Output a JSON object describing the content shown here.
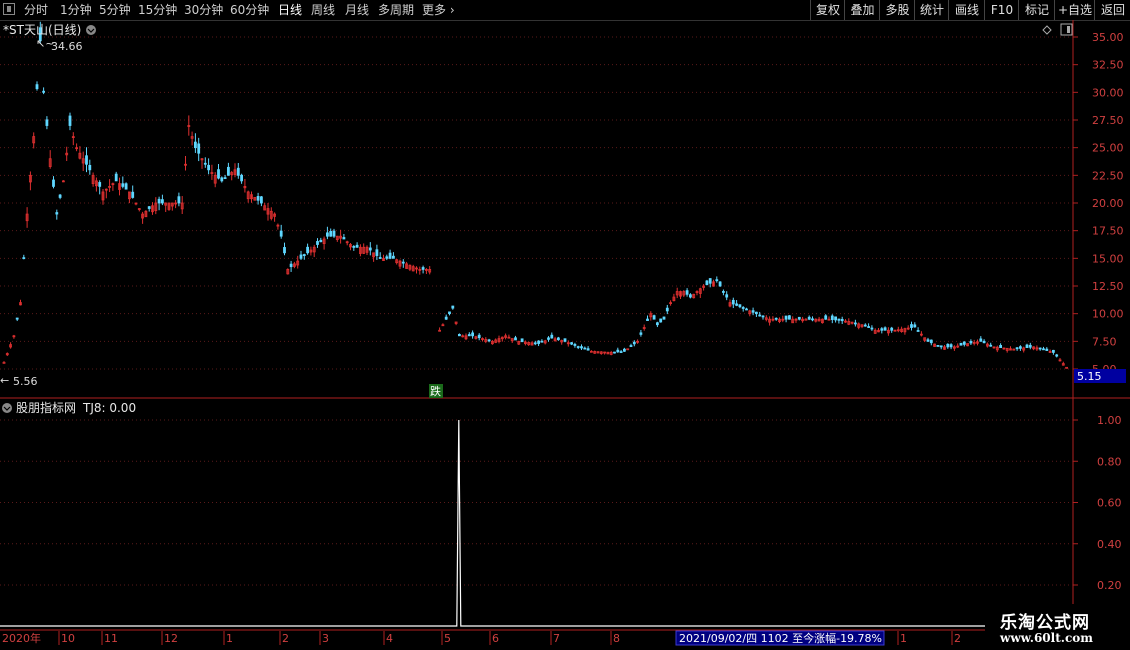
{
  "toolbar": {
    "periods": [
      "分时",
      "1分钟",
      "5分钟",
      "15分钟",
      "30分钟",
      "60分钟",
      "日线",
      "周线",
      "月线",
      "多周期",
      "更多"
    ],
    "active_index": 6,
    "buttons": [
      "复权",
      "叠加",
      "多股",
      "统计",
      "画线",
      "F10",
      "标记",
      "+自选",
      "返回"
    ]
  },
  "main_panel": {
    "title": "*ST天山(日线)",
    "high_label": "34.66",
    "low_label": "5.56",
    "last_price": "5.15",
    "signal_label": "跌"
  },
  "indicator_panel": {
    "title": "股朋指标网",
    "value_label": "TJ8: 0.00"
  },
  "bottom_axis": {
    "year_label": "2020年",
    "months": [
      "10",
      "11",
      "12",
      "1",
      "2",
      "3",
      "4",
      "5",
      "6",
      "7",
      "8",
      "1",
      "2"
    ],
    "status": "2021/09/02/四 1102 至今涨幅-19.78%"
  },
  "watermark": {
    "title": "乐淘公式网",
    "url": "www.60lt.com"
  },
  "colors": {
    "up": "#e03030",
    "down": "#5fd7ff",
    "axis": "#b02020",
    "grid": "#5a1a1a",
    "price_box": "#0000a0",
    "status_bg": "#000080"
  },
  "chart_data": [
    {
      "type": "candlestick",
      "title": "*ST天山(日线)",
      "y_ticks": [
        5.0,
        7.5,
        10.0,
        12.5,
        15.0,
        17.5,
        20.0,
        22.5,
        25.0,
        27.5,
        30.0,
        32.5,
        35.0
      ],
      "ylim": [
        4.5,
        36.5
      ],
      "annotations": {
        "high": 34.66,
        "low": 5.56,
        "last": 5.15
      },
      "close_path": [
        {
          "i": 0,
          "v": 5.6
        },
        {
          "i": 3,
          "v": 8
        },
        {
          "i": 5,
          "v": 11
        },
        {
          "i": 7,
          "v": 19
        },
        {
          "i": 9,
          "v": 26
        },
        {
          "i": 11,
          "v": 34.66
        },
        {
          "i": 12,
          "v": 30
        },
        {
          "i": 14,
          "v": 24
        },
        {
          "i": 16,
          "v": 19
        },
        {
          "i": 18,
          "v": 22
        },
        {
          "i": 20,
          "v": 27
        },
        {
          "i": 22,
          "v": 25
        },
        {
          "i": 26,
          "v": 23
        },
        {
          "i": 30,
          "v": 21
        },
        {
          "i": 34,
          "v": 22
        },
        {
          "i": 38,
          "v": 21
        },
        {
          "i": 42,
          "v": 19
        },
        {
          "i": 46,
          "v": 20
        },
        {
          "i": 50,
          "v": 20
        },
        {
          "i": 54,
          "v": 20
        },
        {
          "i": 56,
          "v": 27
        },
        {
          "i": 58,
          "v": 25
        },
        {
          "i": 62,
          "v": 23
        },
        {
          "i": 66,
          "v": 22
        },
        {
          "i": 70,
          "v": 23
        },
        {
          "i": 74,
          "v": 21
        },
        {
          "i": 78,
          "v": 20
        },
        {
          "i": 82,
          "v": 19
        },
        {
          "i": 84,
          "v": 17
        },
        {
          "i": 86,
          "v": 14
        },
        {
          "i": 90,
          "v": 15
        },
        {
          "i": 94,
          "v": 16
        },
        {
          "i": 98,
          "v": 17
        },
        {
          "i": 102,
          "v": 17
        },
        {
          "i": 106,
          "v": 16
        },
        {
          "i": 110,
          "v": 16
        },
        {
          "i": 114,
          "v": 15
        },
        {
          "i": 118,
          "v": 15
        },
        {
          "i": 122,
          "v": 14.5
        },
        {
          "i": 126,
          "v": 14
        },
        {
          "i": 129,
          "v": 14
        },
        {
          "i": 132,
          "v": 8.5
        },
        {
          "i": 134,
          "v": 9.5
        },
        {
          "i": 136,
          "v": 10.5
        },
        {
          "i": 138,
          "v": 8
        },
        {
          "i": 142,
          "v": 8
        },
        {
          "i": 148,
          "v": 7.5
        },
        {
          "i": 152,
          "v": 8
        },
        {
          "i": 156,
          "v": 7.5
        },
        {
          "i": 162,
          "v": 7.3
        },
        {
          "i": 166,
          "v": 7.8
        },
        {
          "i": 170,
          "v": 7.5
        },
        {
          "i": 174,
          "v": 7
        },
        {
          "i": 178,
          "v": 6.6
        },
        {
          "i": 184,
          "v": 6.5
        },
        {
          "i": 188,
          "v": 6.6
        },
        {
          "i": 192,
          "v": 7.5
        },
        {
          "i": 196,
          "v": 10
        },
        {
          "i": 198,
          "v": 9
        },
        {
          "i": 200,
          "v": 9.5
        },
        {
          "i": 202,
          "v": 11
        },
        {
          "i": 204,
          "v": 12
        },
        {
          "i": 206,
          "v": 12
        },
        {
          "i": 208,
          "v": 11.5
        },
        {
          "i": 212,
          "v": 12.5
        },
        {
          "i": 216,
          "v": 13
        },
        {
          "i": 218,
          "v": 12
        },
        {
          "i": 220,
          "v": 11
        },
        {
          "i": 224,
          "v": 10.5
        },
        {
          "i": 228,
          "v": 10
        },
        {
          "i": 232,
          "v": 9.5
        },
        {
          "i": 238,
          "v": 9.5
        },
        {
          "i": 244,
          "v": 9.5
        },
        {
          "i": 250,
          "v": 9.5
        },
        {
          "i": 256,
          "v": 9.3
        },
        {
          "i": 260,
          "v": 9
        },
        {
          "i": 264,
          "v": 8.5
        },
        {
          "i": 270,
          "v": 8.5
        },
        {
          "i": 276,
          "v": 8.8
        },
        {
          "i": 280,
          "v": 7.5
        },
        {
          "i": 284,
          "v": 7
        },
        {
          "i": 288,
          "v": 7
        },
        {
          "i": 292,
          "v": 7.3
        },
        {
          "i": 296,
          "v": 7.5
        },
        {
          "i": 300,
          "v": 7
        },
        {
          "i": 306,
          "v": 6.8
        },
        {
          "i": 312,
          "v": 7
        },
        {
          "i": 318,
          "v": 6.5
        },
        {
          "i": 322,
          "v": 5.15
        }
      ]
    },
    {
      "type": "line",
      "title": "TJ8",
      "y_ticks": [
        0.2,
        0.4,
        0.6,
        0.8,
        1.0
      ],
      "ylim": [
        0,
        1.05
      ],
      "signal": {
        "i": 136,
        "v": 1.0
      },
      "baseline": 0.0
    }
  ]
}
